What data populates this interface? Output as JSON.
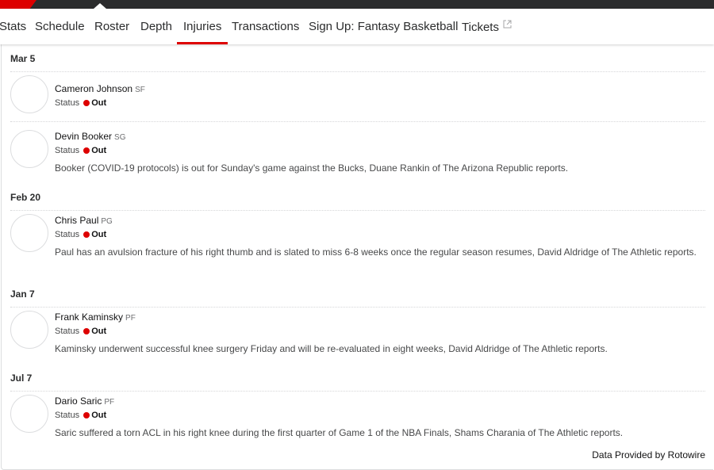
{
  "nav": {
    "items": [
      {
        "label": "Stats"
      },
      {
        "label": "Schedule"
      },
      {
        "label": "Roster"
      },
      {
        "label": "Depth"
      },
      {
        "label": "Injuries"
      },
      {
        "label": "Transactions"
      },
      {
        "label": "Sign Up: Fantasy Basketball"
      },
      {
        "label": "Tickets"
      }
    ],
    "active": "Injuries",
    "external_icon": "external-link-icon"
  },
  "groups": [
    {
      "date": "Mar 5",
      "players": [
        {
          "name": "Cameron Johnson",
          "position": "SF",
          "status_label": "Status",
          "status": "Out",
          "description": ""
        },
        {
          "name": "Devin Booker",
          "position": "SG",
          "status_label": "Status",
          "status": "Out",
          "description": "Booker (COVID-19 protocols) is out for Sunday's game against the Bucks, Duane Rankin of The Arizona Republic reports."
        }
      ]
    },
    {
      "date": "Feb 20",
      "players": [
        {
          "name": "Chris Paul",
          "position": "PG",
          "status_label": "Status",
          "status": "Out",
          "description": "Paul has an avulsion fracture of his right thumb and is slated to miss 6-8 weeks once the regular season resumes, David Aldridge of The Athletic reports."
        }
      ]
    },
    {
      "date": "Jan 7",
      "players": [
        {
          "name": "Frank Kaminsky",
          "position": "PF",
          "status_label": "Status",
          "status": "Out",
          "description": "Kaminsky underwent successful knee surgery Friday and will be re-evaluated in eight weeks, David Aldridge of The Athletic reports."
        }
      ]
    },
    {
      "date": "Jul 7",
      "players": [
        {
          "name": "Dario Saric",
          "position": "PF",
          "status_label": "Status",
          "status": "Out",
          "description": "Saric suffered a torn ACL in his right knee during the first quarter of Game 1 of the NBA Finals, Shams Charania of The Athletic reports."
        }
      ]
    }
  ],
  "colors": {
    "accent": "#dd0000",
    "status_out": "#dd0000"
  },
  "footer": {
    "text": "Data Provided by Rotowire"
  }
}
